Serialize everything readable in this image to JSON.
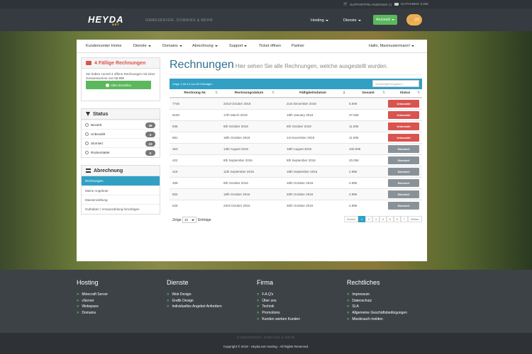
{
  "topbar": {
    "support_pin": "SUPPORTPIN ANZEIGEN (-)",
    "credit": "GUTHABEN: 0,00€"
  },
  "header": {
    "logo": "HEYDA",
    "logo_sub": "NET",
    "tagline": "GAMESERVER, DOMAINS & MEHR",
    "nav": [
      "Hosting",
      "Dienste"
    ],
    "account": "Account",
    "cart_count": "(0)"
  },
  "mainnav": {
    "items": [
      "Kundencenter Home",
      "Dienste",
      "Domains",
      "Abrechnung",
      "Support",
      "Ticket öffnen",
      "Partner"
    ],
    "user": "Hallo, Maxmustermann!"
  },
  "due": {
    "title": "4 Fällige Rechnungen",
    "text": "Sie haben zurzeit 4 offene Rechnungen mit einer Gesamtsumme von 58,99€",
    "button": "Alles bezahlen"
  },
  "status": {
    "title": "Status",
    "items": [
      {
        "label": "Bezahlt",
        "count": "36"
      },
      {
        "label": "Unbezahlt",
        "count": "4"
      },
      {
        "label": "Storniert",
        "count": "23"
      },
      {
        "label": "Rückerstattet",
        "count": "0"
      }
    ]
  },
  "billing": {
    "title": "Abrechnung",
    "items": [
      "Rechnungen",
      "Meine Angebote",
      "Massenzahlung",
      "Guthaben / Vorauszahlung hinzufügen"
    ]
  },
  "page": {
    "title": "Rechnungen",
    "subtitle": "Hier sehen Sie alle Rechnungen, welche ausgestellt wurden."
  },
  "table": {
    "info": "Zeige 1 bis 10 von 63 Einträgen",
    "search_placeholder": "Suchbegriff eingeben...",
    "headers": [
      "Rechnung Nr.",
      "Rechnungsdatum",
      "Fälligkeitsdatum",
      "Gesamt",
      "Status"
    ],
    "rows": [
      {
        "nr": "7745",
        "date": "22nd October 2018",
        "due": "21st December 2018",
        "total": "5.00€",
        "status": "Unbezahlt"
      },
      {
        "nr": "8160",
        "date": "17th March 2019",
        "due": "18th January 2019",
        "total": "37.50€",
        "status": "Unbezahlt"
      },
      {
        "nr": "835",
        "date": "6th October 2019",
        "due": "6th October 2019",
        "total": "11.00€",
        "status": "Unbezahlt"
      },
      {
        "nr": "891",
        "date": "18th October 2019",
        "due": "1st November 2019",
        "total": "11.00€",
        "status": "Unbezahlt"
      },
      {
        "nr": "353",
        "date": "13th August 2016",
        "due": "18th August 2016",
        "total": "100.00€",
        "status": "Storniert"
      },
      {
        "nr": "422",
        "date": "8th September 2016",
        "due": "8th September 2016",
        "total": "20.00€",
        "status": "Storniert"
      },
      {
        "nr": "416",
        "date": "11th September 2016",
        "due": "18th September 2016",
        "total": "2.99€",
        "status": "Storniert"
      },
      {
        "nr": "489",
        "date": "9th October 2016",
        "due": "16th October 2016",
        "total": "4.99€",
        "status": "Storniert"
      },
      {
        "nr": "502",
        "date": "18th October 2016",
        "due": "20th October 2016",
        "total": "4.99€",
        "status": "Storniert"
      },
      {
        "nr": "526",
        "date": "23rd October 2016",
        "due": "30th October 2016",
        "total": "4.99€",
        "status": "Storniert"
      }
    ],
    "length_label_pre": "Zeige",
    "length_value": "10",
    "length_label_post": "Einträge",
    "pagination": [
      "Zurück",
      "1",
      "2",
      "3",
      "4",
      "5",
      "6",
      "7",
      "Weiter"
    ]
  },
  "footer": {
    "cols": [
      {
        "title": "Hosting",
        "items": [
          "Minecraft Server",
          "vServer",
          "Webspace",
          "Domains"
        ]
      },
      {
        "title": "Dienste",
        "items": [
          "Web Design",
          "Grafik Design",
          "Individuelles Angebot Anfordern"
        ]
      },
      {
        "title": "Firma",
        "items": [
          "F.A.Q's",
          "Über uns",
          "Technik",
          "Promotions",
          "Kunden werben Kunden"
        ]
      },
      {
        "title": "Rechtliches",
        "items": [
          "Impressum",
          "Datenschutz",
          "SLA",
          "Allgemeine Geschäftsbedingungen",
          "Missbrauch melden"
        ]
      }
    ],
    "tagline": "GAMESERVER, DOMAINS & MEHR",
    "copyright": "Copyright © 2019 - Heyda.net Hosting - All Rights Reserved."
  },
  "colors": {
    "accent": "#31a0c4",
    "green": "#5cb85c",
    "red": "#d9534f",
    "orange": "#f0ad4e"
  }
}
